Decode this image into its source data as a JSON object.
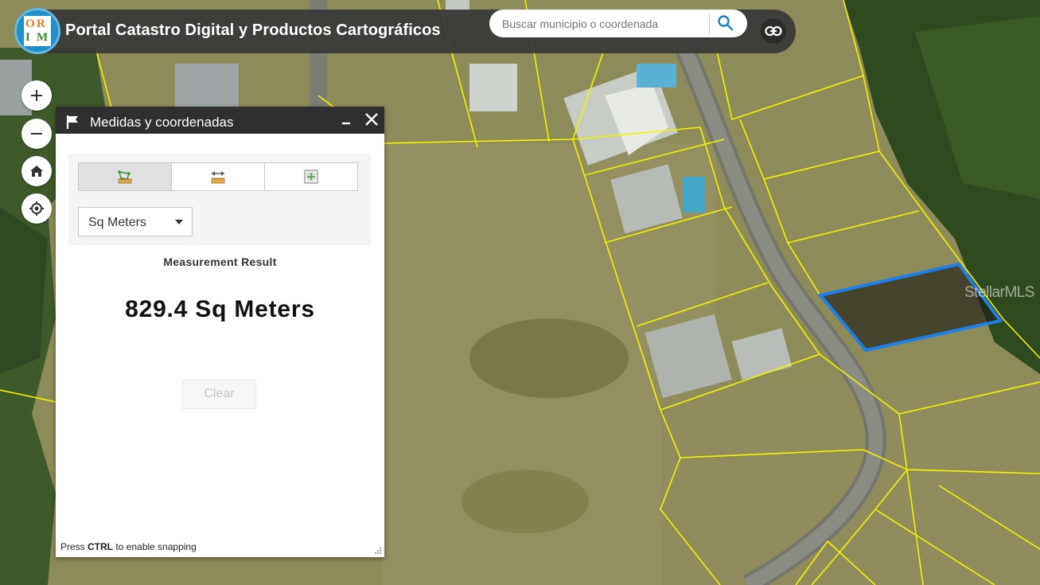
{
  "header": {
    "logo_letters": [
      "O",
      "R",
      "I",
      "M"
    ],
    "title": "Portal Catastro Digital y Productos Cartográficos",
    "search_placeholder": "Buscar municipio o coordenada",
    "icons": {
      "search": "search-icon",
      "link": "link-icon"
    }
  },
  "map_controls": [
    {
      "name": "zoom-in-button",
      "icon": "plus-icon"
    },
    {
      "name": "zoom-out-button",
      "icon": "minus-icon"
    },
    {
      "name": "home-button",
      "icon": "home-icon"
    },
    {
      "name": "locate-button",
      "icon": "locate-icon"
    }
  ],
  "panel": {
    "title": "Medidas y coordenadas",
    "tools": [
      {
        "name": "area-tool",
        "icon": "area-measure-icon",
        "active": true
      },
      {
        "name": "distance-tool",
        "icon": "distance-measure-icon",
        "active": false
      },
      {
        "name": "location-tool",
        "icon": "location-coordinates-icon",
        "active": false
      }
    ],
    "unit": "Sq Meters",
    "result_label": "Measurement Result",
    "result_value": "829.4 Sq Meters",
    "clear_label": "Clear",
    "hint_prefix": "Press ",
    "hint_key": "CTRL",
    "hint_suffix": " to enable snapping"
  },
  "watermark": "StellarMLS",
  "colors": {
    "header_bg": "#373737",
    "parcel_lines": "#f5f500",
    "selected_parcel": "#1f7fe8",
    "accent_blue": "#1e8fc9"
  }
}
